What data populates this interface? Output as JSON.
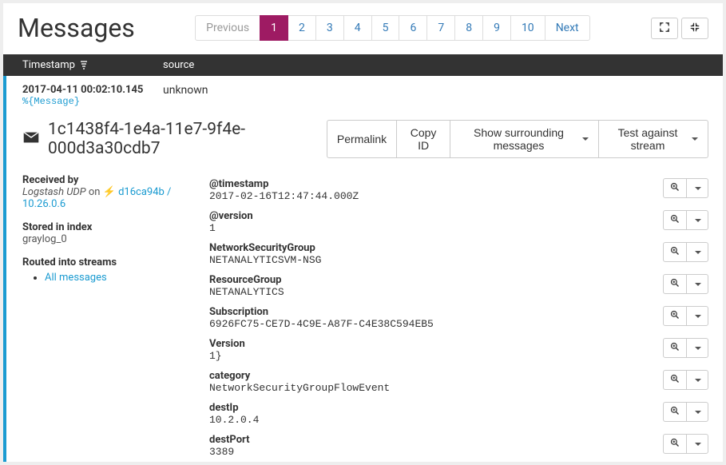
{
  "header": {
    "title": "Messages",
    "pagination": {
      "prev": "Previous",
      "pages": [
        "1",
        "2",
        "3",
        "4",
        "5",
        "6",
        "7",
        "8",
        "9",
        "10"
      ],
      "active": "1",
      "next": "Next"
    }
  },
  "table_head": {
    "timestamp": "Timestamp",
    "source": "source"
  },
  "row": {
    "timestamp": "2017-04-11 00:02:10.145",
    "source": "unknown",
    "expr": "%{Message}"
  },
  "detail": {
    "id": "1c1438f4-1e4a-11e7-9f4e-000d3a30cdb7",
    "actions": {
      "permalink": "Permalink",
      "copy_id": "Copy ID",
      "surrounding": "Show surrounding messages",
      "test_stream": "Test against stream"
    },
    "meta": {
      "received_by_label": "Received by",
      "received_by_input": "Logstash UDP",
      "received_by_on": " on ",
      "received_by_node": "d16ca94b / 10.26.0.6",
      "stored_label": "Stored in index",
      "stored_val": "graylog_0",
      "routed_label": "Routed into streams",
      "stream0": "All messages"
    },
    "fields": [
      {
        "name": "@timestamp",
        "value": "2017-02-16T12:47:44.000Z"
      },
      {
        "name": "@version",
        "value": "1"
      },
      {
        "name": "NetworkSecurityGroup",
        "value": "NETANALYTICSVM-NSG"
      },
      {
        "name": "ResourceGroup",
        "value": "NETANALYTICS"
      },
      {
        "name": "Subscription",
        "value": "6926FC75-CE7D-4C9E-A87F-C4E38C594EB5"
      },
      {
        "name": "Version",
        "value": "1}"
      },
      {
        "name": "category",
        "value": "NetworkSecurityGroupFlowEvent"
      },
      {
        "name": "destIp",
        "value": "10.2.0.4"
      },
      {
        "name": "destPort",
        "value": "3389"
      }
    ]
  }
}
